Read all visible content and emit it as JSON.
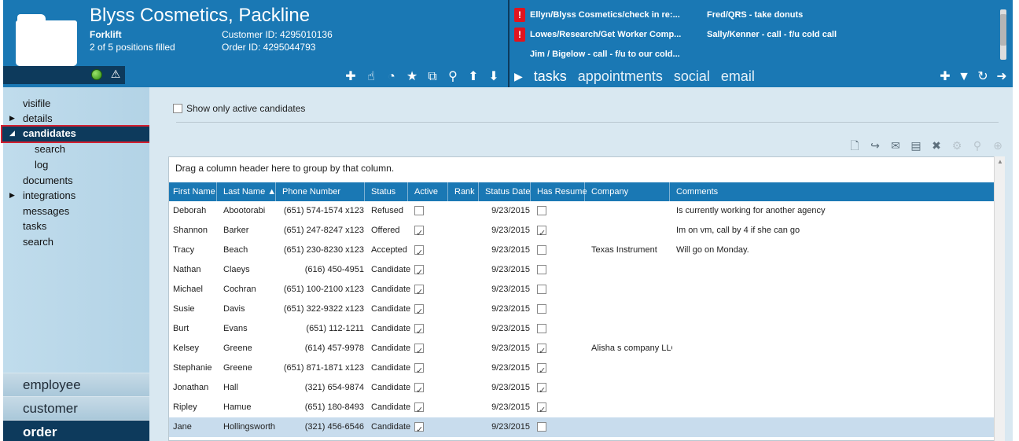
{
  "header": {
    "title": "Blyss Cosmetics, Packline",
    "subtitle": "Forklift",
    "positions": "2 of 5 positions filled",
    "customer_id": "Customer ID: 4295010136",
    "order_id": "Order ID: 4295044793",
    "toolbar_icons": [
      "add-icon",
      "hand-icon",
      "pie-icon",
      "star-icon",
      "open-external-icon",
      "search-icon",
      "arrow-up-icon",
      "arrow-down-icon"
    ]
  },
  "notifications": [
    {
      "text": "Ellyn/Blyss Cosmetics/check in re:...",
      "alert": true
    },
    {
      "text": "Fred/QRS - take donuts",
      "alert": false
    },
    {
      "text": "Lowes/Research/Get Worker Comp...",
      "alert": true
    },
    {
      "text": "Sally/Kenner - call - f/u cold call",
      "alert": false
    },
    {
      "text": "Jim / Bigelow - call - f/u to our cold...",
      "alert": false
    }
  ],
  "activity_tabs": [
    "tasks",
    "appointments",
    "social",
    "email"
  ],
  "activity_toolbar": [
    "add-icon",
    "filter-icon",
    "refresh-icon",
    "arrow-right-icon"
  ],
  "sidebar": {
    "items": [
      {
        "label": "visifile",
        "arrow": ""
      },
      {
        "label": "details",
        "arrow": "▶"
      },
      {
        "label": "candidates",
        "arrow": "◢"
      },
      {
        "label": "search",
        "arrow": ""
      },
      {
        "label": "log",
        "arrow": ""
      },
      {
        "label": "documents",
        "arrow": ""
      },
      {
        "label": "integrations",
        "arrow": "▶"
      },
      {
        "label": "messages",
        "arrow": ""
      },
      {
        "label": "tasks",
        "arrow": ""
      },
      {
        "label": "search",
        "arrow": ""
      }
    ],
    "bottom": [
      "employee",
      "customer",
      "order"
    ]
  },
  "main": {
    "active_only_label": "Show only active candidates",
    "group_hint": "Drag a column header here to group by that column.",
    "toolbar_icons": [
      "document-icon",
      "forward-icon",
      "mail-icon",
      "clipboard-icon",
      "close-icon",
      "gear-icon",
      "zoom-icon",
      "zoom-in-icon"
    ],
    "columns": [
      "First Name",
      "Last Name ▲",
      "Phone Number",
      "Status",
      "Active",
      "Rank",
      "Status Date",
      "Has Resume",
      "Company",
      "Comments"
    ],
    "rows": [
      {
        "first": "Deborah",
        "last": "Abootorabi",
        "phone": "(651) 574-1574 x123",
        "status": "Refused",
        "active": false,
        "rank": "",
        "date": "9/23/2015",
        "resume": false,
        "company": "",
        "comments": "Is currently working for another agency"
      },
      {
        "first": "Shannon",
        "last": "Barker",
        "phone": "(651) 247-8247 x123",
        "status": "Offered",
        "active": true,
        "rank": "",
        "date": "9/23/2015",
        "resume": true,
        "company": "",
        "comments": "Im on vm, call by 4 if she can go"
      },
      {
        "first": "Tracy",
        "last": "Beach",
        "phone": "(651) 230-8230 x123",
        "status": "Accepted",
        "active": true,
        "rank": "",
        "date": "9/23/2015",
        "resume": false,
        "company": "Texas Instrument",
        "comments": "Will go on Monday."
      },
      {
        "first": "Nathan",
        "last": "Claeys",
        "phone": "(616) 450-4951",
        "status": "Candidate",
        "active": true,
        "rank": "",
        "date": "9/23/2015",
        "resume": false,
        "company": "",
        "comments": ""
      },
      {
        "first": "Michael",
        "last": "Cochran",
        "phone": "(651) 100-2100 x123",
        "status": "Candidate",
        "active": true,
        "rank": "",
        "date": "9/23/2015",
        "resume": false,
        "company": "",
        "comments": ""
      },
      {
        "first": "Susie",
        "last": "Davis",
        "phone": "(651) 322-9322 x123",
        "status": "Candidate",
        "active": true,
        "rank": "",
        "date": "9/23/2015",
        "resume": false,
        "company": "",
        "comments": ""
      },
      {
        "first": "Burt",
        "last": "Evans",
        "phone": "(651) 112-1211",
        "status": "Candidate",
        "active": true,
        "rank": "",
        "date": "9/23/2015",
        "resume": false,
        "company": "",
        "comments": ""
      },
      {
        "first": "Kelsey",
        "last": "Greene",
        "phone": "(614) 457-9978",
        "status": "Candidate",
        "active": true,
        "rank": "",
        "date": "9/23/2015",
        "resume": true,
        "company": "Alisha s company LLC",
        "comments": ""
      },
      {
        "first": "Stephanie",
        "last": "Greene",
        "phone": "(651) 871-1871 x123",
        "status": "Candidate",
        "active": true,
        "rank": "",
        "date": "9/23/2015",
        "resume": true,
        "company": "",
        "comments": ""
      },
      {
        "first": "Jonathan",
        "last": "Hall",
        "phone": "(321) 654-9874",
        "status": "Candidate",
        "active": true,
        "rank": "",
        "date": "9/23/2015",
        "resume": true,
        "company": "",
        "comments": ""
      },
      {
        "first": "Ripley",
        "last": "Hamue",
        "phone": "(651) 180-8493",
        "status": "Candidate",
        "active": true,
        "rank": "",
        "date": "9/23/2015",
        "resume": true,
        "company": "",
        "comments": ""
      },
      {
        "first": "Jane",
        "last": "Hollingsworth",
        "phone": "(321) 456-6546",
        "status": "Candidate",
        "active": true,
        "rank": "",
        "date": "9/23/2015",
        "resume": false,
        "company": "",
        "comments": ""
      }
    ]
  },
  "colors": {
    "header_blue": "#1a78b4",
    "navy": "#0d3a5c",
    "alert_red": "#e0141e",
    "selection_outline": "#d32030"
  }
}
